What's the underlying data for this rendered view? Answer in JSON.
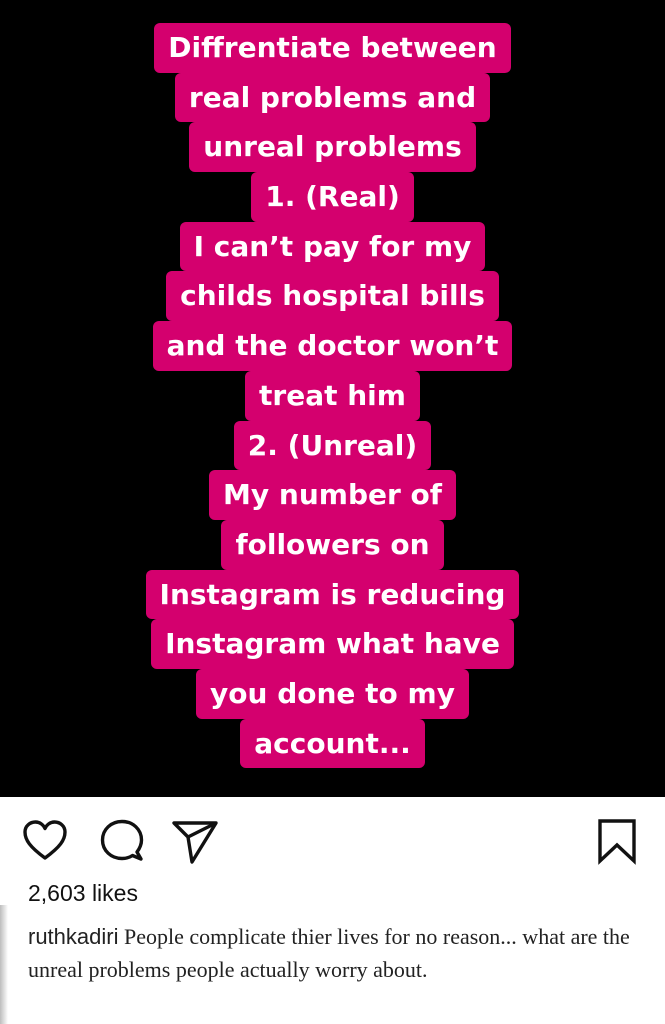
{
  "story": {
    "lines": [
      "Diffrentiate between",
      "real problems and",
      "unreal problems",
      "1.  (Real)",
      "I can’t pay for my",
      "childs hospital bills",
      "and the doctor won’t",
      "treat him",
      "2. (Unreal)",
      "My number of",
      "followers on",
      "Instagram is reducing",
      "Instagram what have",
      "you done to my",
      "account..."
    ],
    "highlight_color": "#d4006e"
  },
  "actions": {
    "like_icon": "heart-outline-icon",
    "comment_icon": "comment-bubble-icon",
    "share_icon": "paper-plane-icon",
    "save_icon": "bookmark-icon"
  },
  "post": {
    "likes": "2,603 likes",
    "username": "ruthkadiri",
    "caption": " People complicate thier lives for no reason... what are the unreal problems people actually worry about."
  }
}
